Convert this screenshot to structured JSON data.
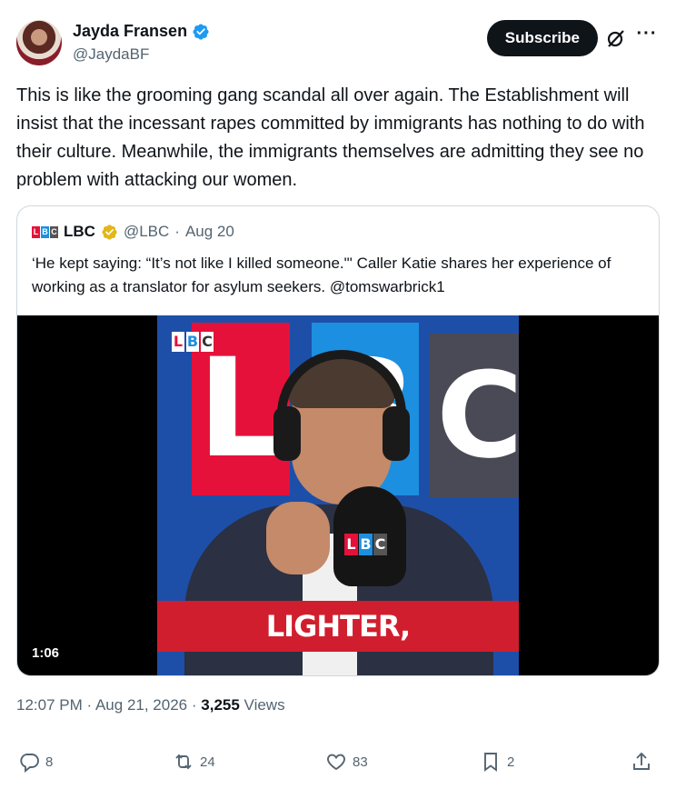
{
  "author": {
    "name": "Jayda Fransen",
    "handle": "@JaydaBF",
    "verified": true
  },
  "actions_top": {
    "subscribe_label": "Subscribe",
    "grok_icon": "grok-icon",
    "more_icon": "more-icon"
  },
  "tweet": {
    "text": "This is like the grooming gang scandal all over again. The Establishment will insist that the incessant rapes committed by immigrants has nothing to do with their culture. Meanwhile, the immigrants themselves are admitting they see no problem with attacking our women."
  },
  "quote": {
    "name": "LBC",
    "handle": "@LBC",
    "date": "Aug 20",
    "separator": "·",
    "text": "‘He kept saying: “It’s not like I killed someone.\"'   Caller Katie shares her experience of working as a translator for asylum seekers.   @tomswarbrick1",
    "media": {
      "logo_letters": [
        "L",
        "B",
        "C"
      ],
      "background_letters": [
        "L",
        "B",
        "C"
      ],
      "caption": "LIGHTER,",
      "duration": "1:06"
    }
  },
  "meta": {
    "time": "12:07 PM",
    "date": "Aug 21, 2026",
    "separator": "·",
    "views_count": "3,255",
    "views_label": "Views"
  },
  "engagement": {
    "replies": "8",
    "reposts": "24",
    "likes": "83",
    "bookmarks": "2"
  },
  "colors": {
    "text": "#0f1419",
    "secondary": "#536471",
    "verified_blue": "#1d9bf0",
    "gold_badge": "#e2b719",
    "lbc_red": "#e5113a",
    "lbc_blue": "#1d8fe0"
  }
}
